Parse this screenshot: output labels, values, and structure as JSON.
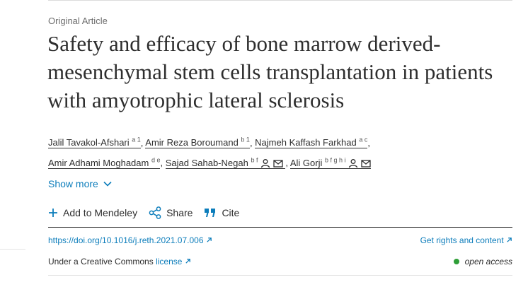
{
  "article_type": "Original Article",
  "title": "Safety and efficacy of bone marrow derived-mesenchymal stem cells transplantation in patients with amyotrophic lateral sclerosis",
  "authors": [
    {
      "name": "Jalil Tavakol-Afshari",
      "sup": "a 1"
    },
    {
      "name": "Amir Reza Boroumand",
      "sup": "b 1"
    },
    {
      "name": "Najmeh Kaffash Farkhad",
      "sup": "a c"
    },
    {
      "name": "Amir Adhami Moghadam",
      "sup": "d e"
    },
    {
      "name": "Sajad Sahab-Negah",
      "sup": "b f"
    },
    {
      "name": "Ali Gorji",
      "sup": "b f g h i"
    }
  ],
  "show_more": "Show more",
  "actions": {
    "mendeley": "Add to Mendeley",
    "share": "Share",
    "cite": "Cite"
  },
  "doi": "https://doi.org/10.1016/j.reth.2021.07.006",
  "rights": "Get rights and content",
  "license": {
    "prefix": "Under a Creative Commons",
    "link": "license"
  },
  "open_access": "open access",
  "colors": {
    "link": "#0c7dbb",
    "text": "#2e2e2e",
    "open_access_dot": "#2e9e37"
  }
}
